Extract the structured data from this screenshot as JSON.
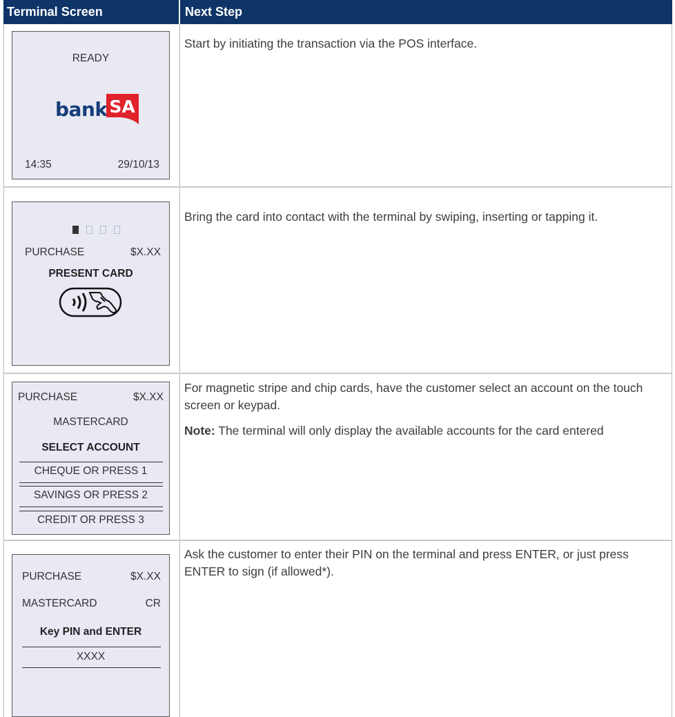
{
  "header": {
    "col1": "Terminal Screen",
    "col2": "Next Step"
  },
  "rows": [
    {
      "screen": {
        "status": "READY",
        "logo": {
          "text": "bank",
          "badge": "SA",
          "badge_color": "#e0222a",
          "text_color": "#163d7a"
        },
        "time": "14:35",
        "date": "29/10/13"
      },
      "step": "Start by initiating the transaction via the POS interface."
    },
    {
      "screen": {
        "progress_steps": 4,
        "progress_active": 1,
        "purchase_label": "PURCHASE",
        "amount": "$X.XX",
        "prompt": "PRESENT CARD",
        "icon": "contactless-icon"
      },
      "step": "Bring the card into contact with the terminal by swiping, inserting or tapping it."
    },
    {
      "screen": {
        "purchase_label": "PURCHASE",
        "amount": "$X.XX",
        "card": "MASTERCARD",
        "prompt": "SELECT ACCOUNT",
        "options": [
          "CHEQUE OR PRESS 1",
          "SAVINGS OR PRESS 2",
          "CREDIT OR PRESS 3"
        ]
      },
      "step": "For magnetic stripe and chip cards, have the customer select an account on the touch screen or keypad.",
      "note_label": "Note:",
      "note": " The terminal will only display the available accounts for the card entered"
    },
    {
      "screen": {
        "purchase_label": "PURCHASE",
        "amount": "$X.XX",
        "card": "MASTERCARD",
        "account": "CR",
        "prompt": "Key PIN and ENTER",
        "pin": "XXXX"
      },
      "step": "Ask the customer to enter their PIN on the terminal and press ENTER, or just press ENTER to sign (if allowed*)."
    }
  ]
}
